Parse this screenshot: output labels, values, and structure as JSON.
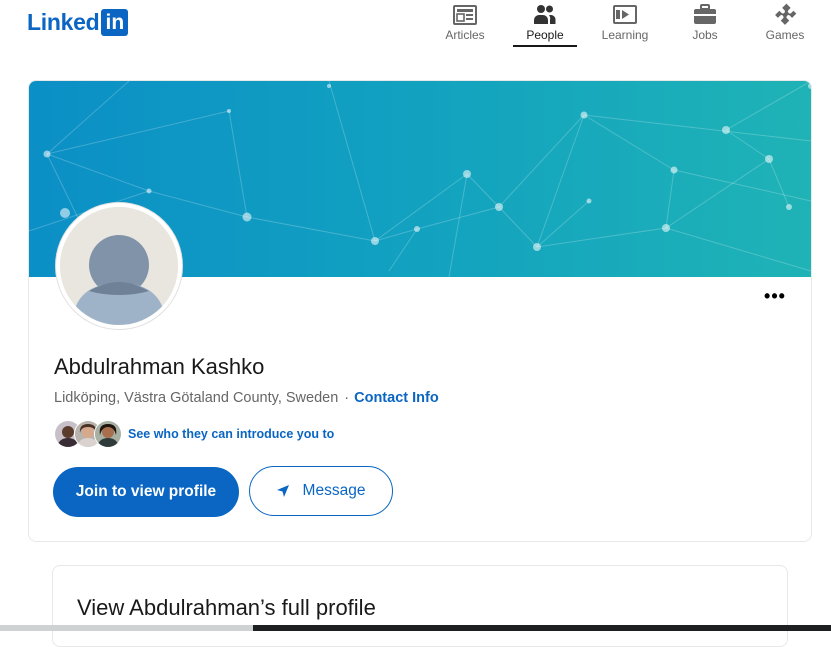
{
  "brand": {
    "logo_text": "Linked",
    "logo_box": "in"
  },
  "nav": [
    {
      "label": "Articles",
      "icon": "articles-icon"
    },
    {
      "label": "People",
      "icon": "people-icon",
      "active": true
    },
    {
      "label": "Learning",
      "icon": "learning-icon"
    },
    {
      "label": "Jobs",
      "icon": "jobs-icon"
    },
    {
      "label": "Games",
      "icon": "games-icon"
    }
  ],
  "profile": {
    "name": "Abdulrahman Kashko",
    "location": "Lidköping, Västra Götaland County, Sweden",
    "separator": "·",
    "contact_info": "Contact Info",
    "introduce_text": "See who they can introduce you to",
    "more_label": "•••"
  },
  "actions": {
    "join_label": "Join to view profile",
    "message_label": "Message"
  },
  "full_profile": {
    "title": "View Abdulrahman’s full profile"
  },
  "colors": {
    "brand_blue": "#0a66c2",
    "banner_start": "#0a8fc4",
    "banner_end": "#1bb0b8"
  }
}
